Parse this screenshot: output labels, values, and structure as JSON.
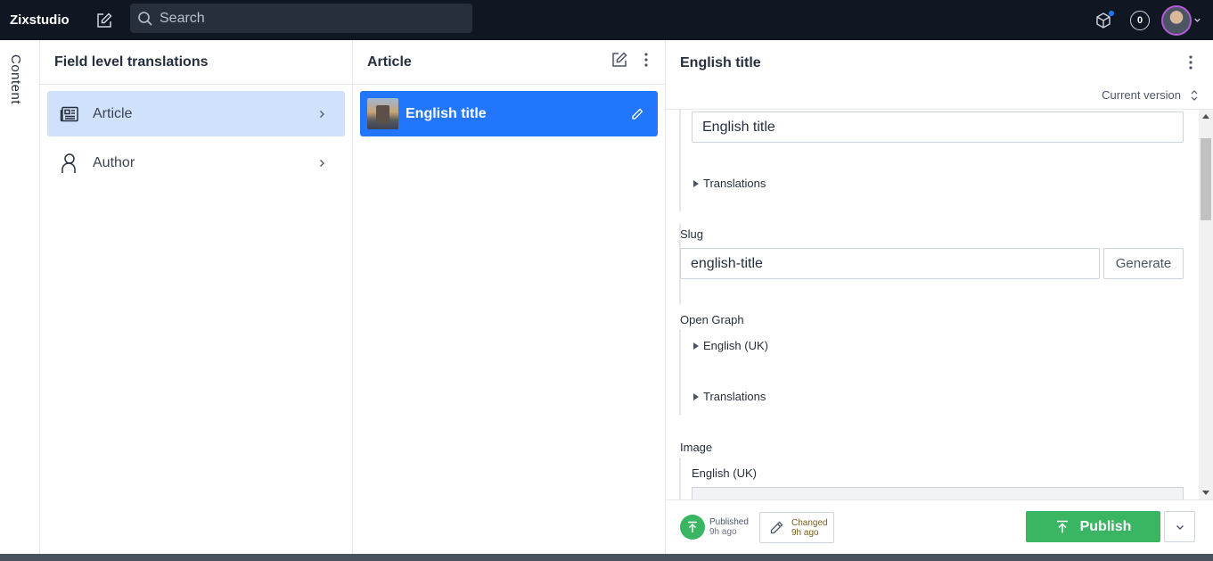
{
  "topbar": {
    "brand": "Zixstudio",
    "search_placeholder": "Search",
    "notification_count": "0"
  },
  "rail": {
    "label": "Content"
  },
  "pane_types": {
    "title": "Field level translations",
    "items": [
      {
        "label": "Article",
        "icon": "document-icon",
        "selected": true
      },
      {
        "label": "Author",
        "icon": "user-icon",
        "selected": false
      }
    ]
  },
  "pane_documents": {
    "title": "Article",
    "items": [
      {
        "label": "English title",
        "selected": true
      }
    ]
  },
  "editor": {
    "title": "English title",
    "version_label": "Current version",
    "title_field": {
      "value": "English title",
      "translations_label": "Translations"
    },
    "slug": {
      "label": "Slug",
      "value": "english-title",
      "generate_label": "Generate"
    },
    "open_graph": {
      "label": "Open Graph",
      "english_label": "English (UK)",
      "translations_label": "Translations"
    },
    "image": {
      "label": "Image",
      "english_label": "English (UK)"
    }
  },
  "footer": {
    "published": {
      "status": "Published",
      "time": "9h ago"
    },
    "changed": {
      "status": "Changed",
      "time": "9h ago"
    },
    "publish_label": "Publish"
  },
  "colors": {
    "topbar_bg": "#101722",
    "accent": "#2276fc",
    "selected_bg": "#d0e1fb",
    "publish_green": "#3ab564"
  }
}
